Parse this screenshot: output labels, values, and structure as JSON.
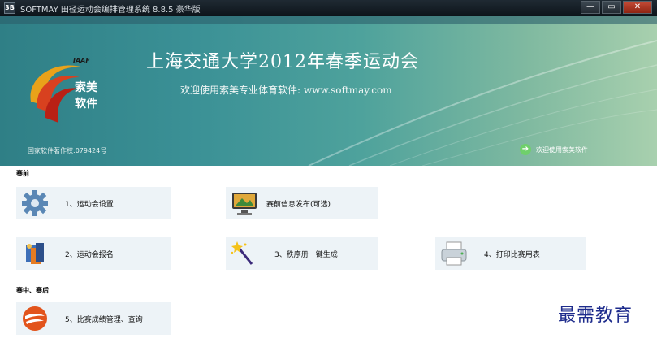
{
  "window": {
    "title": "SOFTMAY 田径运动会编排管理系统 8.8.5 豪华版",
    "app_icon": "3B",
    "buttons": {
      "minimize": "—",
      "maximize": "▭",
      "close": "✕"
    }
  },
  "banner": {
    "logo": {
      "iaaf": "IAAF",
      "line1": "索美",
      "line2": "软件"
    },
    "title": "上海交通大学2012年春季运动会",
    "subtitle": "欢迎使用索美专业体育软件: www.softmay.com",
    "copyright": "国家软件著作权:079424号",
    "welcome": "欢迎使用索美软件"
  },
  "sections": {
    "pre": "赛前",
    "during": "赛中、赛后"
  },
  "cards": [
    {
      "label": "1、运动会设置",
      "icon": "gear-icon"
    },
    {
      "label": "赛前信息发布(可选)",
      "icon": "monitor-icon"
    },
    {
      "label": "2、运动会报名",
      "icon": "signup-icon"
    },
    {
      "label": "3、秩序册一键生成",
      "icon": "magic-wand-icon"
    },
    {
      "label": "4、打印比赛用表",
      "icon": "printer-icon"
    },
    {
      "label": "5、比赛成绩管理、查询",
      "icon": "results-icon"
    }
  ],
  "watermark": "最需教育",
  "colors": {
    "banner_teal": "#3b9196",
    "card_bg": "#edf3f7",
    "watermark": "#1d2b8c"
  }
}
